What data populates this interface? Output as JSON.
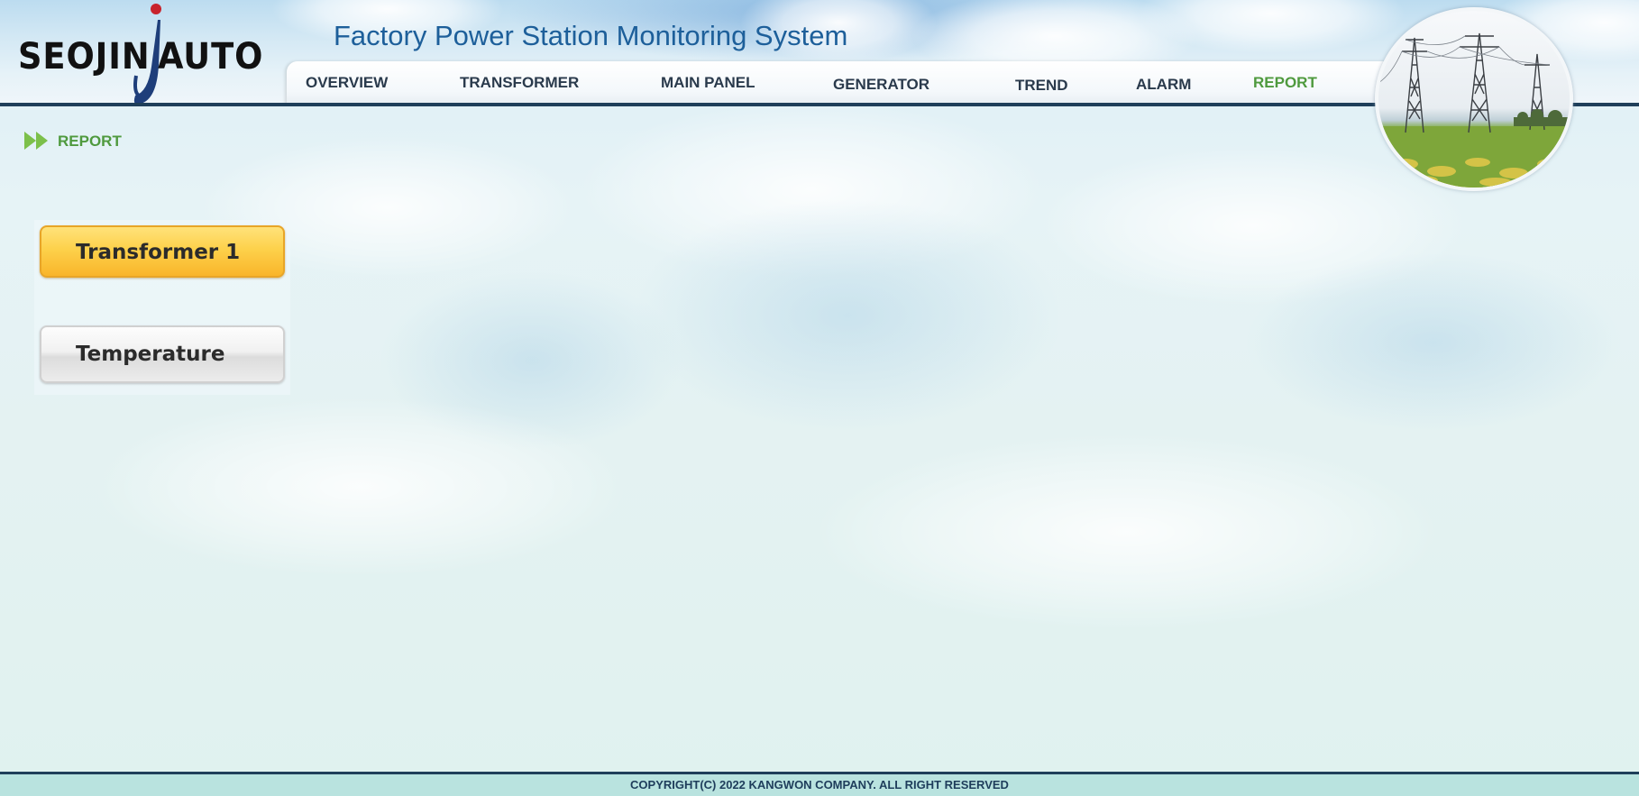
{
  "header": {
    "logo_left": "SEOJIN",
    "logo_right": "AUTO",
    "app_title": "Factory Power Station Monitoring System"
  },
  "nav": {
    "items": [
      {
        "label": "OVERVIEW"
      },
      {
        "label": "TRANSFORMER"
      },
      {
        "label": "MAIN PANEL"
      },
      {
        "label": "GENERATOR"
      },
      {
        "label": "TREND"
      },
      {
        "label": "ALARM"
      },
      {
        "label": "REPORT",
        "active": true
      }
    ]
  },
  "breadcrumb": {
    "label": "REPORT"
  },
  "report_buttons": [
    {
      "label": "Transformer 1",
      "selected": true
    },
    {
      "label": "Temperature",
      "selected": false
    }
  ],
  "footer": {
    "copyright": "COPYRIGHT(C) 2022 KANGWON COMPANY. ALL RIGHT RESERVED"
  },
  "colors": {
    "title_blue": "#1d5f9a",
    "nav_text": "#2a3a4c",
    "active_green": "#4f9a3e",
    "header_line": "#1f3f5a",
    "selected_button": "#fdd14b",
    "footer_bg": "#b9e3df"
  }
}
